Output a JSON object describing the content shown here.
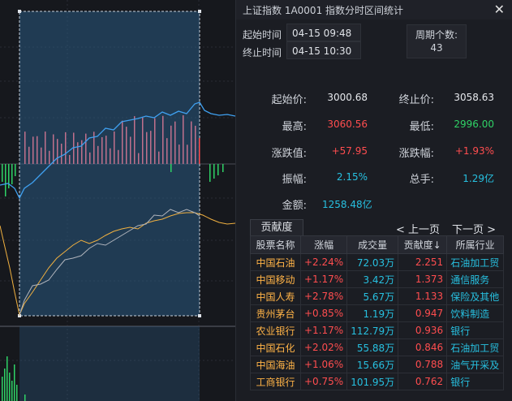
{
  "window": {
    "title": "上证指数  1A0001  指数分时区间统计"
  },
  "time": {
    "start_label": "起始时间",
    "start_value": "04-15 09:48",
    "end_label": "终止时间",
    "end_value": "04-15 10:30"
  },
  "period": {
    "label": "周期个数:",
    "value": "43"
  },
  "stats": {
    "start_price_label": "起始价:",
    "start_price": "3000.68",
    "end_price_label": "终止价:",
    "end_price": "3058.63",
    "high_label": "最高:",
    "high": "3060.56",
    "low_label": "最低:",
    "low": "2996.00",
    "change_label": "涨跌值:",
    "change": "+57.95",
    "change_pct_label": "涨跌幅:",
    "change_pct": "+1.93%",
    "amplitude_label": "振幅:",
    "amplitude": "2.15%",
    "volume_label": "总手:",
    "volume": "1.29亿",
    "amount_label": "金额:",
    "amount": "1258.48亿"
  },
  "contrib": {
    "tab": "贡献度",
    "prev": "< 上一页",
    "next": "下一页 >",
    "headers": [
      "股票名称",
      "涨幅",
      "成交量",
      "贡献度↓",
      "所属行业"
    ],
    "rows": [
      [
        "中国石油",
        "+2.24%",
        "72.03万",
        "2.251",
        "石油加工贸"
      ],
      [
        "中国移动",
        "+1.17%",
        "3.42万",
        "1.373",
        "通信服务"
      ],
      [
        "中国人寿",
        "+2.78%",
        "5.67万",
        "1.133",
        "保险及其他"
      ],
      [
        "贵州茅台",
        "+0.85%",
        "1.19万",
        "0.947",
        "饮料制造"
      ],
      [
        "农业银行",
        "+1.17%",
        "112.79万",
        "0.936",
        "银行"
      ],
      [
        "中国石化",
        "+2.02%",
        "55.88万",
        "0.846",
        "石油加工贸"
      ],
      [
        "中国海油",
        "+1.06%",
        "15.66万",
        "0.788",
        "油气开采及"
      ],
      [
        "工商银行",
        "+0.75%",
        "101.95万",
        "0.762",
        "银行"
      ]
    ]
  },
  "colors": {
    "up": "#ff4d4f",
    "down": "#2fd266",
    "price_line": "#3fa0f0",
    "avg_line": "#f0b040",
    "selection": "#2a5a80"
  }
}
